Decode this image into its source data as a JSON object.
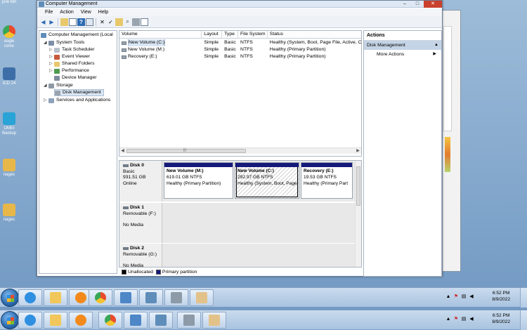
{
  "window": {
    "title": "Computer Management",
    "min": "–",
    "max": "□",
    "close": "✕"
  },
  "menu": [
    "File",
    "Action",
    "View",
    "Help"
  ],
  "tree": {
    "root": "Computer Management (Local",
    "system_tools": "System Tools",
    "task_scheduler": "Task Scheduler",
    "event_viewer": "Event Viewer",
    "shared_folders": "Shared Folders",
    "performance": "Performance",
    "device_manager": "Device Manager",
    "storage": "Storage",
    "disk_management": "Disk Management",
    "services": "Services and Applications"
  },
  "volume_list": {
    "headers": [
      "Volume",
      "Layout",
      "Type",
      "File System",
      "Status"
    ],
    "rows": [
      {
        "volume": "New Volume (C:)",
        "layout": "Simple",
        "type": "Basic",
        "fs": "NTFS",
        "status": "Healthy (System, Boot, Page File, Active, C"
      },
      {
        "volume": "New Volume (M:)",
        "layout": "Simple",
        "type": "Basic",
        "fs": "NTFS",
        "status": "Healthy (Primary Partition)"
      },
      {
        "volume": "Recovery (E:)",
        "layout": "Simple",
        "type": "Basic",
        "fs": "NTFS",
        "status": "Healthy (Primary Partition)"
      }
    ],
    "scroll_grip": "|||"
  },
  "disks": [
    {
      "name": "Disk 0",
      "type": "Basic",
      "size": "931.51 GB",
      "state": "Online",
      "partitions": [
        {
          "name": "New Volume  (M:)",
          "size": "619.01 GB NTFS",
          "status": "Healthy (Primary Partition)"
        },
        {
          "name": "New Volume  (C:)",
          "size": "292.97 GB NTFS",
          "status": "Healthy (System, Boot, Page"
        },
        {
          "name": "Recovery  (E:)",
          "size": "19.53 GB NTFS",
          "status": "Healthy (Primary Part"
        }
      ]
    },
    {
      "name": "Disk 1",
      "type": "Removable (F:)",
      "state": "No Media"
    },
    {
      "name": "Disk 2",
      "type": "Removable (G:)",
      "state": "No Media"
    }
  ],
  "legend": {
    "unallocated": "Unallocated",
    "primary": "Primary partition",
    "colors": {
      "unallocated": "#000000",
      "primary": "#14197a"
    }
  },
  "actions": {
    "header": "Actions",
    "section": "Disk Management",
    "more": "More Actions"
  },
  "desktop_icons": [
    {
      "label": "ycle Bin",
      "icon": "recycle-bin-icon"
    },
    {
      "label": "oogle\nrome",
      "icon": "chrome-icon"
    },
    {
      "label": "ICD 24",
      "icon": "computer-icon"
    },
    {
      "label": "OMEI\nBackup",
      "icon": "aomei-icon"
    },
    {
      "label": "nages",
      "icon": "folder-icon"
    },
    {
      "label": "nages",
      "icon": "folder-icon"
    }
  ],
  "taskbar": {
    "time": "6:52 PM",
    "date": "8/9/2022",
    "apps": [
      "internet-explorer-icon",
      "explorer-folder-icon",
      "media-player-icon",
      "chrome-icon",
      "network-icon",
      "computer-management-icon",
      "printer-icon",
      "paint-icon"
    ]
  },
  "icon_colors": {
    "ie": "#2f8fe0",
    "folder": "#f1c75b",
    "media": "#f28a1b",
    "chrome": "#e94b2c"
  }
}
